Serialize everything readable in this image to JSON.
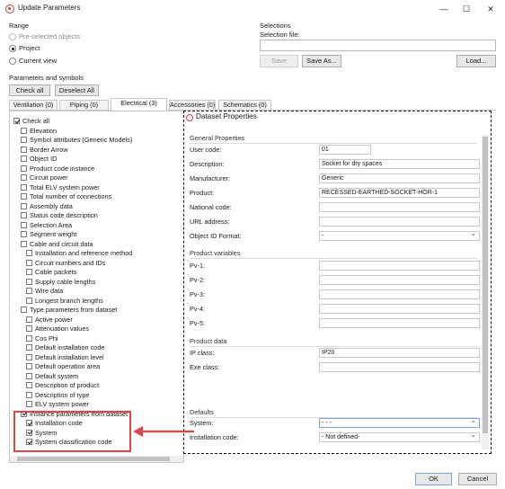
{
  "window": {
    "title": "Update Parameters",
    "controls": [
      "—",
      "☐",
      "✕"
    ]
  },
  "range": {
    "title": "Range",
    "options": [
      {
        "label": "Pre-selected objects",
        "checked": false,
        "disabled": true
      },
      {
        "label": "Project",
        "checked": true,
        "disabled": false
      },
      {
        "label": "Current view",
        "checked": false,
        "disabled": false
      }
    ]
  },
  "selections": {
    "title": "Selections",
    "file_label": "Selection file:",
    "file_value": "",
    "save_label": "Save",
    "save_as_label": "Save As...",
    "load_label": "Load..."
  },
  "params": {
    "title": "Parameters and symbols",
    "check_all_label": "Check all",
    "deselect_all_label": "Deselect All",
    "tabs": [
      {
        "label": "Ventilation (0)",
        "active": false
      },
      {
        "label": "Piping (0)",
        "active": false
      },
      {
        "label": "Electrical (3)",
        "active": true
      },
      {
        "label": "Accessories (0)",
        "active": false
      },
      {
        "label": "Schematics (0)",
        "active": false
      }
    ],
    "tree": [
      {
        "label": "Check all",
        "level": 0,
        "checked": true
      },
      {
        "label": "Elevation",
        "level": 1,
        "checked": false
      },
      {
        "label": "Symbol attributes (Generic Models)",
        "level": 1,
        "checked": false
      },
      {
        "label": "Border Arrow",
        "level": 1,
        "checked": false
      },
      {
        "label": "Object ID",
        "level": 1,
        "checked": false
      },
      {
        "label": "Product code instance",
        "level": 1,
        "checked": false
      },
      {
        "label": "Circuit power",
        "level": 1,
        "checked": false
      },
      {
        "label": "Total ELV system power",
        "level": 1,
        "checked": false
      },
      {
        "label": "Total number of connections",
        "level": 1,
        "checked": false
      },
      {
        "label": "Assembly data",
        "level": 1,
        "checked": false
      },
      {
        "label": "Status code description",
        "level": 1,
        "checked": false
      },
      {
        "label": "Selection Area",
        "level": 1,
        "checked": false
      },
      {
        "label": "Segment weight",
        "level": 1,
        "checked": false
      },
      {
        "label": "Cable and circuit data",
        "level": 1,
        "checked": false
      },
      {
        "label": "Installation and reference method",
        "level": 2,
        "checked": false
      },
      {
        "label": "Circuit numbers and IDs",
        "level": 2,
        "checked": false
      },
      {
        "label": "Cable packets",
        "level": 2,
        "checked": false
      },
      {
        "label": "Supply cable lengths",
        "level": 2,
        "checked": false
      },
      {
        "label": "Wire data",
        "level": 2,
        "checked": false
      },
      {
        "label": "Longest branch lengths",
        "level": 2,
        "checked": false
      },
      {
        "label": "Type parameters from dataset",
        "level": 1,
        "checked": false
      },
      {
        "label": "Active power",
        "level": 2,
        "checked": false
      },
      {
        "label": "Attenuation values",
        "level": 2,
        "checked": false
      },
      {
        "label": "Cos Phi",
        "level": 2,
        "checked": false
      },
      {
        "label": "Default installation code",
        "level": 2,
        "checked": false
      },
      {
        "label": "Default installation level",
        "level": 2,
        "checked": false
      },
      {
        "label": "Default operation area",
        "level": 2,
        "checked": false
      },
      {
        "label": "Default system",
        "level": 2,
        "checked": false
      },
      {
        "label": "Description of product",
        "level": 2,
        "checked": false
      },
      {
        "label": "Description of type",
        "level": 2,
        "checked": false
      },
      {
        "label": "ELV system power",
        "level": 2,
        "checked": false
      },
      {
        "label": "Instance parameters from dataset",
        "level": 1,
        "checked": true
      },
      {
        "label": "Installation code",
        "level": 2,
        "checked": true
      },
      {
        "label": "System",
        "level": 2,
        "checked": true
      },
      {
        "label": "System classification code",
        "level": 2,
        "checked": true
      }
    ]
  },
  "dataset": {
    "title": "Dataset Properties",
    "general_title": "General Properties",
    "general": [
      {
        "label": "User code:",
        "value": "01"
      },
      {
        "label": "Description:",
        "value": "Socket for dry spaces"
      },
      {
        "label": "Manufacturer:",
        "value": "Generic"
      },
      {
        "label": "Product:",
        "value": "RECESSED-EARTHED-SOCKET-HOR-1"
      },
      {
        "label": "National code:",
        "value": ""
      },
      {
        "label": "URL address:",
        "value": ""
      },
      {
        "label": "Object ID Format:",
        "value": "-"
      }
    ],
    "variables_title": "Product variables",
    "variables": [
      {
        "label": "Pv-1:",
        "value": ""
      },
      {
        "label": "Pv-2:",
        "value": ""
      },
      {
        "label": "Pv-3:",
        "value": ""
      },
      {
        "label": "Pv-4:",
        "value": ""
      },
      {
        "label": "Pv-5:",
        "value": ""
      }
    ],
    "product_title": "Product data",
    "product": [
      {
        "label": "IP class:",
        "value": "IP20"
      },
      {
        "label": "Exe class:",
        "value": ""
      }
    ],
    "defaults_title": "Defaults",
    "defaults": [
      {
        "label": "System:",
        "value": "- - -"
      },
      {
        "label": "Installation code:",
        "value": "- Not defined-"
      }
    ]
  },
  "footer": {
    "ok_label": "OK",
    "cancel_label": "Cancel"
  },
  "colors": {
    "accent_red": "#e0454a",
    "focus_blue": "#7aa7e0"
  }
}
